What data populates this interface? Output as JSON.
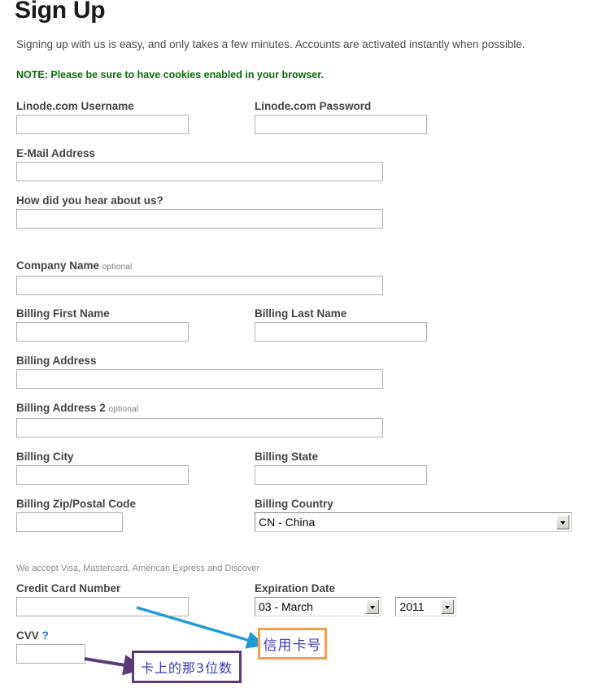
{
  "header": {
    "title": "Sign Up",
    "intro": "Signing up with us is easy, and only takes a few minutes. Accounts are activated instantly when possible.",
    "note": "NOTE: Please be sure to have cookies enabled in your browser."
  },
  "form": {
    "username": {
      "label": "Linode.com Username",
      "value": ""
    },
    "password": {
      "label": "Linode.com Password",
      "value": ""
    },
    "email": {
      "label": "E-Mail Address",
      "value": ""
    },
    "referral": {
      "label": "How did you hear about us?",
      "value": ""
    },
    "company": {
      "label": "Company Name",
      "optional": "optional",
      "value": ""
    },
    "billing_first_name": {
      "label": "Billing First Name",
      "value": ""
    },
    "billing_last_name": {
      "label": "Billing Last Name",
      "value": ""
    },
    "billing_address": {
      "label": "Billing Address",
      "value": ""
    },
    "billing_address2": {
      "label": "Billing Address 2",
      "optional": "optional",
      "value": ""
    },
    "billing_city": {
      "label": "Billing City",
      "value": ""
    },
    "billing_state": {
      "label": "Billing State",
      "value": ""
    },
    "billing_zip": {
      "label": "Billing Zip/Postal Code",
      "value": ""
    },
    "billing_country": {
      "label": "Billing Country",
      "selected": "CN - China"
    },
    "cards_accepted": "We accept Visa, Mastercard, American Express and Discover",
    "credit_card_number": {
      "label": "Credit Card Number",
      "value": ""
    },
    "expiration": {
      "label": "Expiration Date",
      "month_selected": "03 - March",
      "year_selected": "2011"
    },
    "cvv": {
      "label": "CVV",
      "help": "?",
      "value": ""
    }
  },
  "annotations": {
    "credit_card_note": {
      "text": "信用卡号",
      "border_color": "#f0a050",
      "text_color": "#3a3ab0"
    },
    "cvv_note": {
      "text": "卡上的那3位数",
      "border_color": "#5b3a78",
      "text_color": "#3a3ab0"
    },
    "arrow_credit_card_color": "#1f9ad6",
    "arrow_cvv_color": "#5b3a78"
  }
}
